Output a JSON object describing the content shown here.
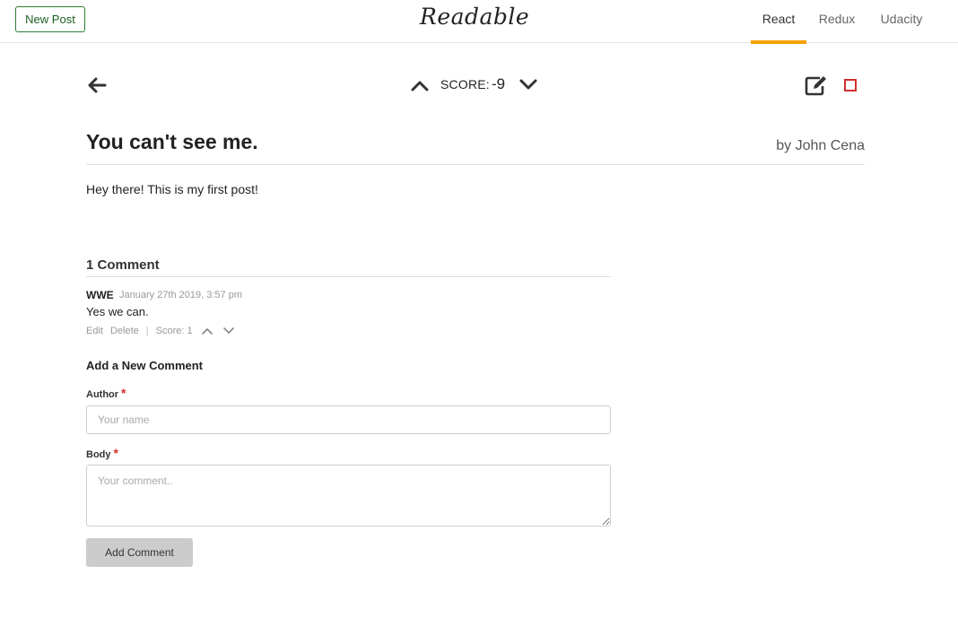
{
  "header": {
    "new_post_label": "New Post",
    "brand": "Readable",
    "tabs": [
      {
        "label": "React",
        "active": true
      },
      {
        "label": "Redux",
        "active": false
      },
      {
        "label": "Udacity",
        "active": false
      }
    ],
    "accent_color": "#f5a000"
  },
  "post": {
    "score_label": "SCORE:",
    "score": "-9",
    "title": "You can't see me.",
    "author": "by John Cena",
    "body": "Hey there! This is my first post!",
    "icons": {
      "back": "arrow-left-icon",
      "upvote": "chevron-up-icon",
      "downvote": "chevron-down-icon",
      "edit": "edit-icon",
      "delete": "delete-square-icon"
    },
    "delete_color": "#d32f2f"
  },
  "comments": {
    "heading": "1 Comment",
    "items": [
      {
        "author": "WWE",
        "date": "January 27th 2019, 3:57 pm",
        "body": "Yes we can.",
        "edit_label": "Edit",
        "delete_label": "Delete",
        "separator": "|",
        "score_text": "Score: 1"
      }
    ]
  },
  "new_comment_form": {
    "heading": "Add a New Comment",
    "author_label": "Author",
    "author_placeholder": "Your name",
    "body_label": "Body",
    "body_placeholder": "Your comment..",
    "required_mark": "*",
    "submit_label": "Add Comment"
  }
}
